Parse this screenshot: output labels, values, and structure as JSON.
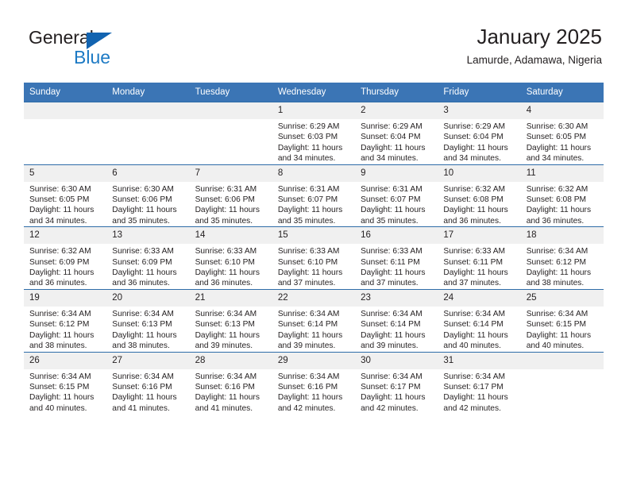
{
  "brand": {
    "name_part1": "General",
    "name_part2": "Blue",
    "accent_color": "#1d7ac4",
    "triangle_color": "#1263b0"
  },
  "header": {
    "title": "January 2025",
    "subtitle": "Lamurde, Adamawa, Nigeria",
    "header_bg_color": "#3b75b5",
    "row_divider_color": "#2e6ca8",
    "daynum_bg_color": "#f0f0f0"
  },
  "weekday_headers": [
    "Sunday",
    "Monday",
    "Tuesday",
    "Wednesday",
    "Thursday",
    "Friday",
    "Saturday"
  ],
  "weeks": [
    [
      {
        "day": "",
        "sunrise": "",
        "sunset": "",
        "daylight_line1": "",
        "daylight_line2": ""
      },
      {
        "day": "",
        "sunrise": "",
        "sunset": "",
        "daylight_line1": "",
        "daylight_line2": ""
      },
      {
        "day": "",
        "sunrise": "",
        "sunset": "",
        "daylight_line1": "",
        "daylight_line2": ""
      },
      {
        "day": "1",
        "sunrise": "Sunrise: 6:29 AM",
        "sunset": "Sunset: 6:03 PM",
        "daylight_line1": "Daylight: 11 hours",
        "daylight_line2": "and 34 minutes."
      },
      {
        "day": "2",
        "sunrise": "Sunrise: 6:29 AM",
        "sunset": "Sunset: 6:04 PM",
        "daylight_line1": "Daylight: 11 hours",
        "daylight_line2": "and 34 minutes."
      },
      {
        "day": "3",
        "sunrise": "Sunrise: 6:29 AM",
        "sunset": "Sunset: 6:04 PM",
        "daylight_line1": "Daylight: 11 hours",
        "daylight_line2": "and 34 minutes."
      },
      {
        "day": "4",
        "sunrise": "Sunrise: 6:30 AM",
        "sunset": "Sunset: 6:05 PM",
        "daylight_line1": "Daylight: 11 hours",
        "daylight_line2": "and 34 minutes."
      }
    ],
    [
      {
        "day": "5",
        "sunrise": "Sunrise: 6:30 AM",
        "sunset": "Sunset: 6:05 PM",
        "daylight_line1": "Daylight: 11 hours",
        "daylight_line2": "and 34 minutes."
      },
      {
        "day": "6",
        "sunrise": "Sunrise: 6:30 AM",
        "sunset": "Sunset: 6:06 PM",
        "daylight_line1": "Daylight: 11 hours",
        "daylight_line2": "and 35 minutes."
      },
      {
        "day": "7",
        "sunrise": "Sunrise: 6:31 AM",
        "sunset": "Sunset: 6:06 PM",
        "daylight_line1": "Daylight: 11 hours",
        "daylight_line2": "and 35 minutes."
      },
      {
        "day": "8",
        "sunrise": "Sunrise: 6:31 AM",
        "sunset": "Sunset: 6:07 PM",
        "daylight_line1": "Daylight: 11 hours",
        "daylight_line2": "and 35 minutes."
      },
      {
        "day": "9",
        "sunrise": "Sunrise: 6:31 AM",
        "sunset": "Sunset: 6:07 PM",
        "daylight_line1": "Daylight: 11 hours",
        "daylight_line2": "and 35 minutes."
      },
      {
        "day": "10",
        "sunrise": "Sunrise: 6:32 AM",
        "sunset": "Sunset: 6:08 PM",
        "daylight_line1": "Daylight: 11 hours",
        "daylight_line2": "and 36 minutes."
      },
      {
        "day": "11",
        "sunrise": "Sunrise: 6:32 AM",
        "sunset": "Sunset: 6:08 PM",
        "daylight_line1": "Daylight: 11 hours",
        "daylight_line2": "and 36 minutes."
      }
    ],
    [
      {
        "day": "12",
        "sunrise": "Sunrise: 6:32 AM",
        "sunset": "Sunset: 6:09 PM",
        "daylight_line1": "Daylight: 11 hours",
        "daylight_line2": "and 36 minutes."
      },
      {
        "day": "13",
        "sunrise": "Sunrise: 6:33 AM",
        "sunset": "Sunset: 6:09 PM",
        "daylight_line1": "Daylight: 11 hours",
        "daylight_line2": "and 36 minutes."
      },
      {
        "day": "14",
        "sunrise": "Sunrise: 6:33 AM",
        "sunset": "Sunset: 6:10 PM",
        "daylight_line1": "Daylight: 11 hours",
        "daylight_line2": "and 36 minutes."
      },
      {
        "day": "15",
        "sunrise": "Sunrise: 6:33 AM",
        "sunset": "Sunset: 6:10 PM",
        "daylight_line1": "Daylight: 11 hours",
        "daylight_line2": "and 37 minutes."
      },
      {
        "day": "16",
        "sunrise": "Sunrise: 6:33 AM",
        "sunset": "Sunset: 6:11 PM",
        "daylight_line1": "Daylight: 11 hours",
        "daylight_line2": "and 37 minutes."
      },
      {
        "day": "17",
        "sunrise": "Sunrise: 6:33 AM",
        "sunset": "Sunset: 6:11 PM",
        "daylight_line1": "Daylight: 11 hours",
        "daylight_line2": "and 37 minutes."
      },
      {
        "day": "18",
        "sunrise": "Sunrise: 6:34 AM",
        "sunset": "Sunset: 6:12 PM",
        "daylight_line1": "Daylight: 11 hours",
        "daylight_line2": "and 38 minutes."
      }
    ],
    [
      {
        "day": "19",
        "sunrise": "Sunrise: 6:34 AM",
        "sunset": "Sunset: 6:12 PM",
        "daylight_line1": "Daylight: 11 hours",
        "daylight_line2": "and 38 minutes."
      },
      {
        "day": "20",
        "sunrise": "Sunrise: 6:34 AM",
        "sunset": "Sunset: 6:13 PM",
        "daylight_line1": "Daylight: 11 hours",
        "daylight_line2": "and 38 minutes."
      },
      {
        "day": "21",
        "sunrise": "Sunrise: 6:34 AM",
        "sunset": "Sunset: 6:13 PM",
        "daylight_line1": "Daylight: 11 hours",
        "daylight_line2": "and 39 minutes."
      },
      {
        "day": "22",
        "sunrise": "Sunrise: 6:34 AM",
        "sunset": "Sunset: 6:14 PM",
        "daylight_line1": "Daylight: 11 hours",
        "daylight_line2": "and 39 minutes."
      },
      {
        "day": "23",
        "sunrise": "Sunrise: 6:34 AM",
        "sunset": "Sunset: 6:14 PM",
        "daylight_line1": "Daylight: 11 hours",
        "daylight_line2": "and 39 minutes."
      },
      {
        "day": "24",
        "sunrise": "Sunrise: 6:34 AM",
        "sunset": "Sunset: 6:14 PM",
        "daylight_line1": "Daylight: 11 hours",
        "daylight_line2": "and 40 minutes."
      },
      {
        "day": "25",
        "sunrise": "Sunrise: 6:34 AM",
        "sunset": "Sunset: 6:15 PM",
        "daylight_line1": "Daylight: 11 hours",
        "daylight_line2": "and 40 minutes."
      }
    ],
    [
      {
        "day": "26",
        "sunrise": "Sunrise: 6:34 AM",
        "sunset": "Sunset: 6:15 PM",
        "daylight_line1": "Daylight: 11 hours",
        "daylight_line2": "and 40 minutes."
      },
      {
        "day": "27",
        "sunrise": "Sunrise: 6:34 AM",
        "sunset": "Sunset: 6:16 PM",
        "daylight_line1": "Daylight: 11 hours",
        "daylight_line2": "and 41 minutes."
      },
      {
        "day": "28",
        "sunrise": "Sunrise: 6:34 AM",
        "sunset": "Sunset: 6:16 PM",
        "daylight_line1": "Daylight: 11 hours",
        "daylight_line2": "and 41 minutes."
      },
      {
        "day": "29",
        "sunrise": "Sunrise: 6:34 AM",
        "sunset": "Sunset: 6:16 PM",
        "daylight_line1": "Daylight: 11 hours",
        "daylight_line2": "and 42 minutes."
      },
      {
        "day": "30",
        "sunrise": "Sunrise: 6:34 AM",
        "sunset": "Sunset: 6:17 PM",
        "daylight_line1": "Daylight: 11 hours",
        "daylight_line2": "and 42 minutes."
      },
      {
        "day": "31",
        "sunrise": "Sunrise: 6:34 AM",
        "sunset": "Sunset: 6:17 PM",
        "daylight_line1": "Daylight: 11 hours",
        "daylight_line2": "and 42 minutes."
      },
      {
        "day": "",
        "sunrise": "",
        "sunset": "",
        "daylight_line1": "",
        "daylight_line2": ""
      }
    ]
  ]
}
